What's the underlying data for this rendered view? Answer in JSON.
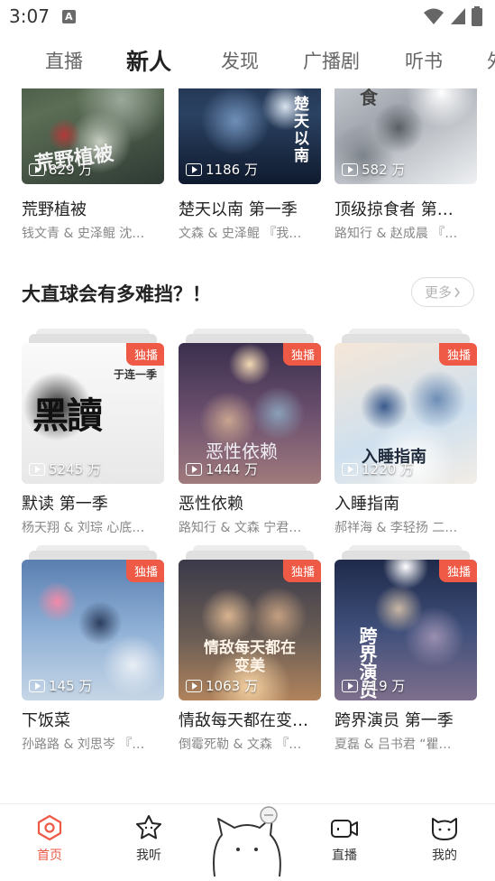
{
  "status": {
    "time": "3:07",
    "notification": "A"
  },
  "top_tabs": [
    {
      "label": "直播"
    },
    {
      "label": "新人"
    },
    {
      "label": "发现"
    },
    {
      "label": "广播剧"
    },
    {
      "label": "听书"
    },
    {
      "label": "外"
    }
  ],
  "top_row": [
    {
      "plays": "829 万",
      "title": "荒野植被",
      "sub": "钱文青 & 史泽鲲 沈…"
    },
    {
      "plays": "1186 万",
      "title": "楚天以南 第一季",
      "sub": "文森 & 史泽鲲 『我…"
    },
    {
      "plays": "582 万",
      "title": "顶级掠食者 第…",
      "sub": "路知行 & 赵成晨 『…"
    }
  ],
  "section": {
    "title": "大直球会有多难挡？！",
    "more_label": "更多"
  },
  "grid": [
    {
      "badge": "独播",
      "plays": "5245 万",
      "title": "默读 第一季",
      "sub": "杨天翔 & 刘琮 心底…"
    },
    {
      "badge": "独播",
      "plays": "1444 万",
      "title": "恶性依赖",
      "sub": "路知行 & 文森 宁君…"
    },
    {
      "badge": "独播",
      "plays": "1220 万",
      "title": "入睡指南",
      "sub": "郝祥海 & 李轻扬 二…"
    },
    {
      "badge": "独播",
      "plays": "145 万",
      "title": "下饭菜",
      "sub": "孙路路 & 刘思岑 『…"
    },
    {
      "badge": "独播",
      "plays": "1063 万",
      "title": "情敌每天都在变…",
      "sub": "倒霉死勒 & 文森 『…"
    },
    {
      "badge": "独播",
      "plays": "719 万",
      "title": "跨界演员 第一季",
      "sub": "夏磊 & 吕书君 “瞿…"
    }
  ],
  "cover_texts": {
    "c0": "荒野植被",
    "c1": "楚天以南",
    "c2": "食",
    "g0": "黑讀",
    "g0b": "于连一季",
    "g1": "恶性依赖",
    "g2": "入睡指南",
    "g4": "情敌每天都在变美",
    "g5": "跨界演员"
  },
  "bottom_nav": [
    {
      "label": "首页",
      "icon": "home-icon"
    },
    {
      "label": "我听",
      "icon": "star-icon"
    },
    {
      "label": "直播",
      "icon": "video-camera-icon"
    },
    {
      "label": "我的",
      "icon": "cat-face-icon"
    }
  ],
  "colors": {
    "accent": "#ee5a46",
    "text": "#222222",
    "subtext": "#888888"
  }
}
